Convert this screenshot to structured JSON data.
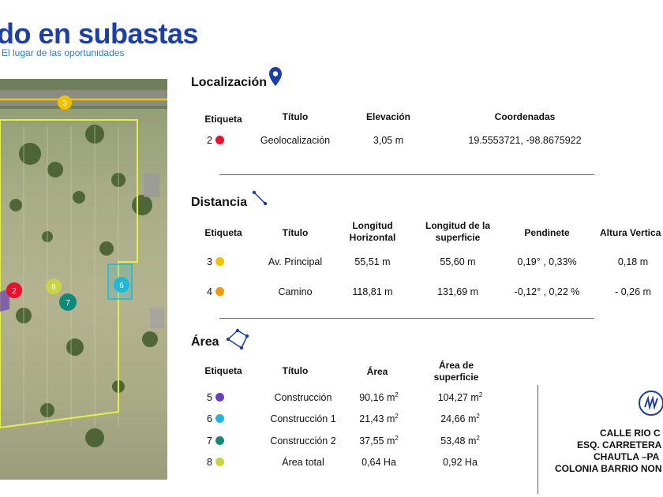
{
  "logo": {
    "main": "do en subastas",
    "tagline": "El lugar de las oportunidades"
  },
  "map": {
    "markers": [
      {
        "label": "3",
        "color": "#f2c200"
      },
      {
        "label": "2",
        "color": "#e8102e"
      },
      {
        "label": "8",
        "color": "#c9d443"
      },
      {
        "label": "7",
        "color": "#0f8a7a"
      },
      {
        "label": "6",
        "color": "#1fb8d8"
      }
    ]
  },
  "localizacion": {
    "title": "Localización",
    "headers": [
      "Etiqueta",
      "Título",
      "Elevación",
      "Coordenadas"
    ],
    "rows": [
      {
        "etiqueta": "2",
        "color": "#e8102e",
        "titulo": "Geolocalización",
        "elevacion": "3,05 m",
        "coordenadas": "19.5553721, -98.8675922"
      }
    ]
  },
  "distancia": {
    "title": "Distancia",
    "headers": [
      "Etiqueta",
      "Título",
      "Longitud Horizontal",
      "Longitud de la superficie",
      "Pendinete",
      "Altura Vertica"
    ],
    "rows": [
      {
        "etiqueta": "3",
        "color": "#f2c200",
        "titulo": "Av. Principal",
        "lh": "55,51 m",
        "ls": "55,60 m",
        "pend": "0,19° , 0,33%",
        "alt": "0,18 m"
      },
      {
        "etiqueta": "4",
        "color": "#f39a0a",
        "titulo": "Camino",
        "lh": "118,81 m",
        "ls": "131,69 m",
        "pend": "-0,12° , 0,22 %",
        "alt": "- 0,26 m"
      }
    ]
  },
  "area": {
    "title": "Área",
    "headers": [
      "Etiqueta",
      "Título",
      "Área",
      "Área de superficie"
    ],
    "rows": [
      {
        "etiqueta": "5",
        "color": "#6b3fb5",
        "titulo": "Construcción",
        "area": "90,16 m",
        "area_sup": "104,27 m",
        "unit_sup": "2"
      },
      {
        "etiqueta": "6",
        "color": "#1fb8d8",
        "titulo": "Construcción 1",
        "area": "21,43 m",
        "area_sup": "24,66 m",
        "unit_sup": "2"
      },
      {
        "etiqueta": "7",
        "color": "#0f8a7a",
        "titulo": "Construcción 2",
        "area": "37,55 m",
        "area_sup": "53,48 m",
        "unit_sup": "2"
      },
      {
        "etiqueta": "8",
        "color": "#c9d443",
        "titulo": "Área total",
        "area": "0,64 Ha",
        "area_sup": "0,92 Ha",
        "unit_sup": ""
      }
    ]
  },
  "address": {
    "lines": [
      "CALLE RIO C",
      "ESQ. CARRETERA",
      "CHAUTLA –PA",
      "COLONIA BARRIO NON"
    ]
  },
  "colors": {
    "brand": "#1c3fa8",
    "pin": "#1c3fa8",
    "boundary": "#e4f04a"
  }
}
